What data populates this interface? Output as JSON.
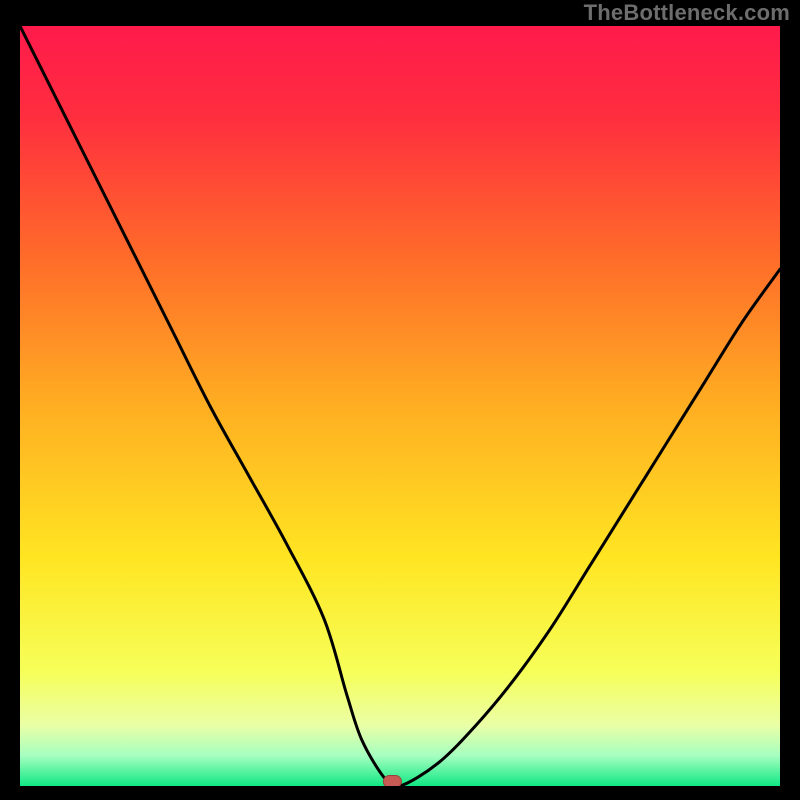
{
  "watermark": "TheBottleneck.com",
  "chart_data": {
    "type": "line",
    "title": "",
    "xlabel": "",
    "ylabel": "",
    "xlim": [
      0,
      100
    ],
    "ylim": [
      0,
      100
    ],
    "x": [
      0,
      5,
      10,
      15,
      20,
      25,
      30,
      35,
      40,
      43,
      45,
      48,
      50,
      55,
      60,
      65,
      70,
      75,
      80,
      85,
      90,
      95,
      100
    ],
    "values": [
      100,
      90,
      80,
      70,
      60,
      50,
      41,
      32,
      22,
      12,
      6,
      1,
      0,
      3,
      8,
      14,
      21,
      29,
      37,
      45,
      53,
      61,
      68
    ],
    "marker": {
      "x": 49,
      "y": 0.6
    },
    "gradient_stops": [
      {
        "pos": 0.0,
        "color": "#ff1a4b"
      },
      {
        "pos": 0.12,
        "color": "#ff2e3f"
      },
      {
        "pos": 0.3,
        "color": "#ff6a2a"
      },
      {
        "pos": 0.5,
        "color": "#ffae22"
      },
      {
        "pos": 0.7,
        "color": "#ffe522"
      },
      {
        "pos": 0.85,
        "color": "#f6ff59"
      },
      {
        "pos": 0.92,
        "color": "#eaffa6"
      },
      {
        "pos": 0.96,
        "color": "#a6ffc0"
      },
      {
        "pos": 1.0,
        "color": "#10e884"
      }
    ],
    "colors": {
      "curve": "#000000",
      "marker_fill": "#c85a54",
      "marker_stroke": "#9e3e3a"
    }
  }
}
